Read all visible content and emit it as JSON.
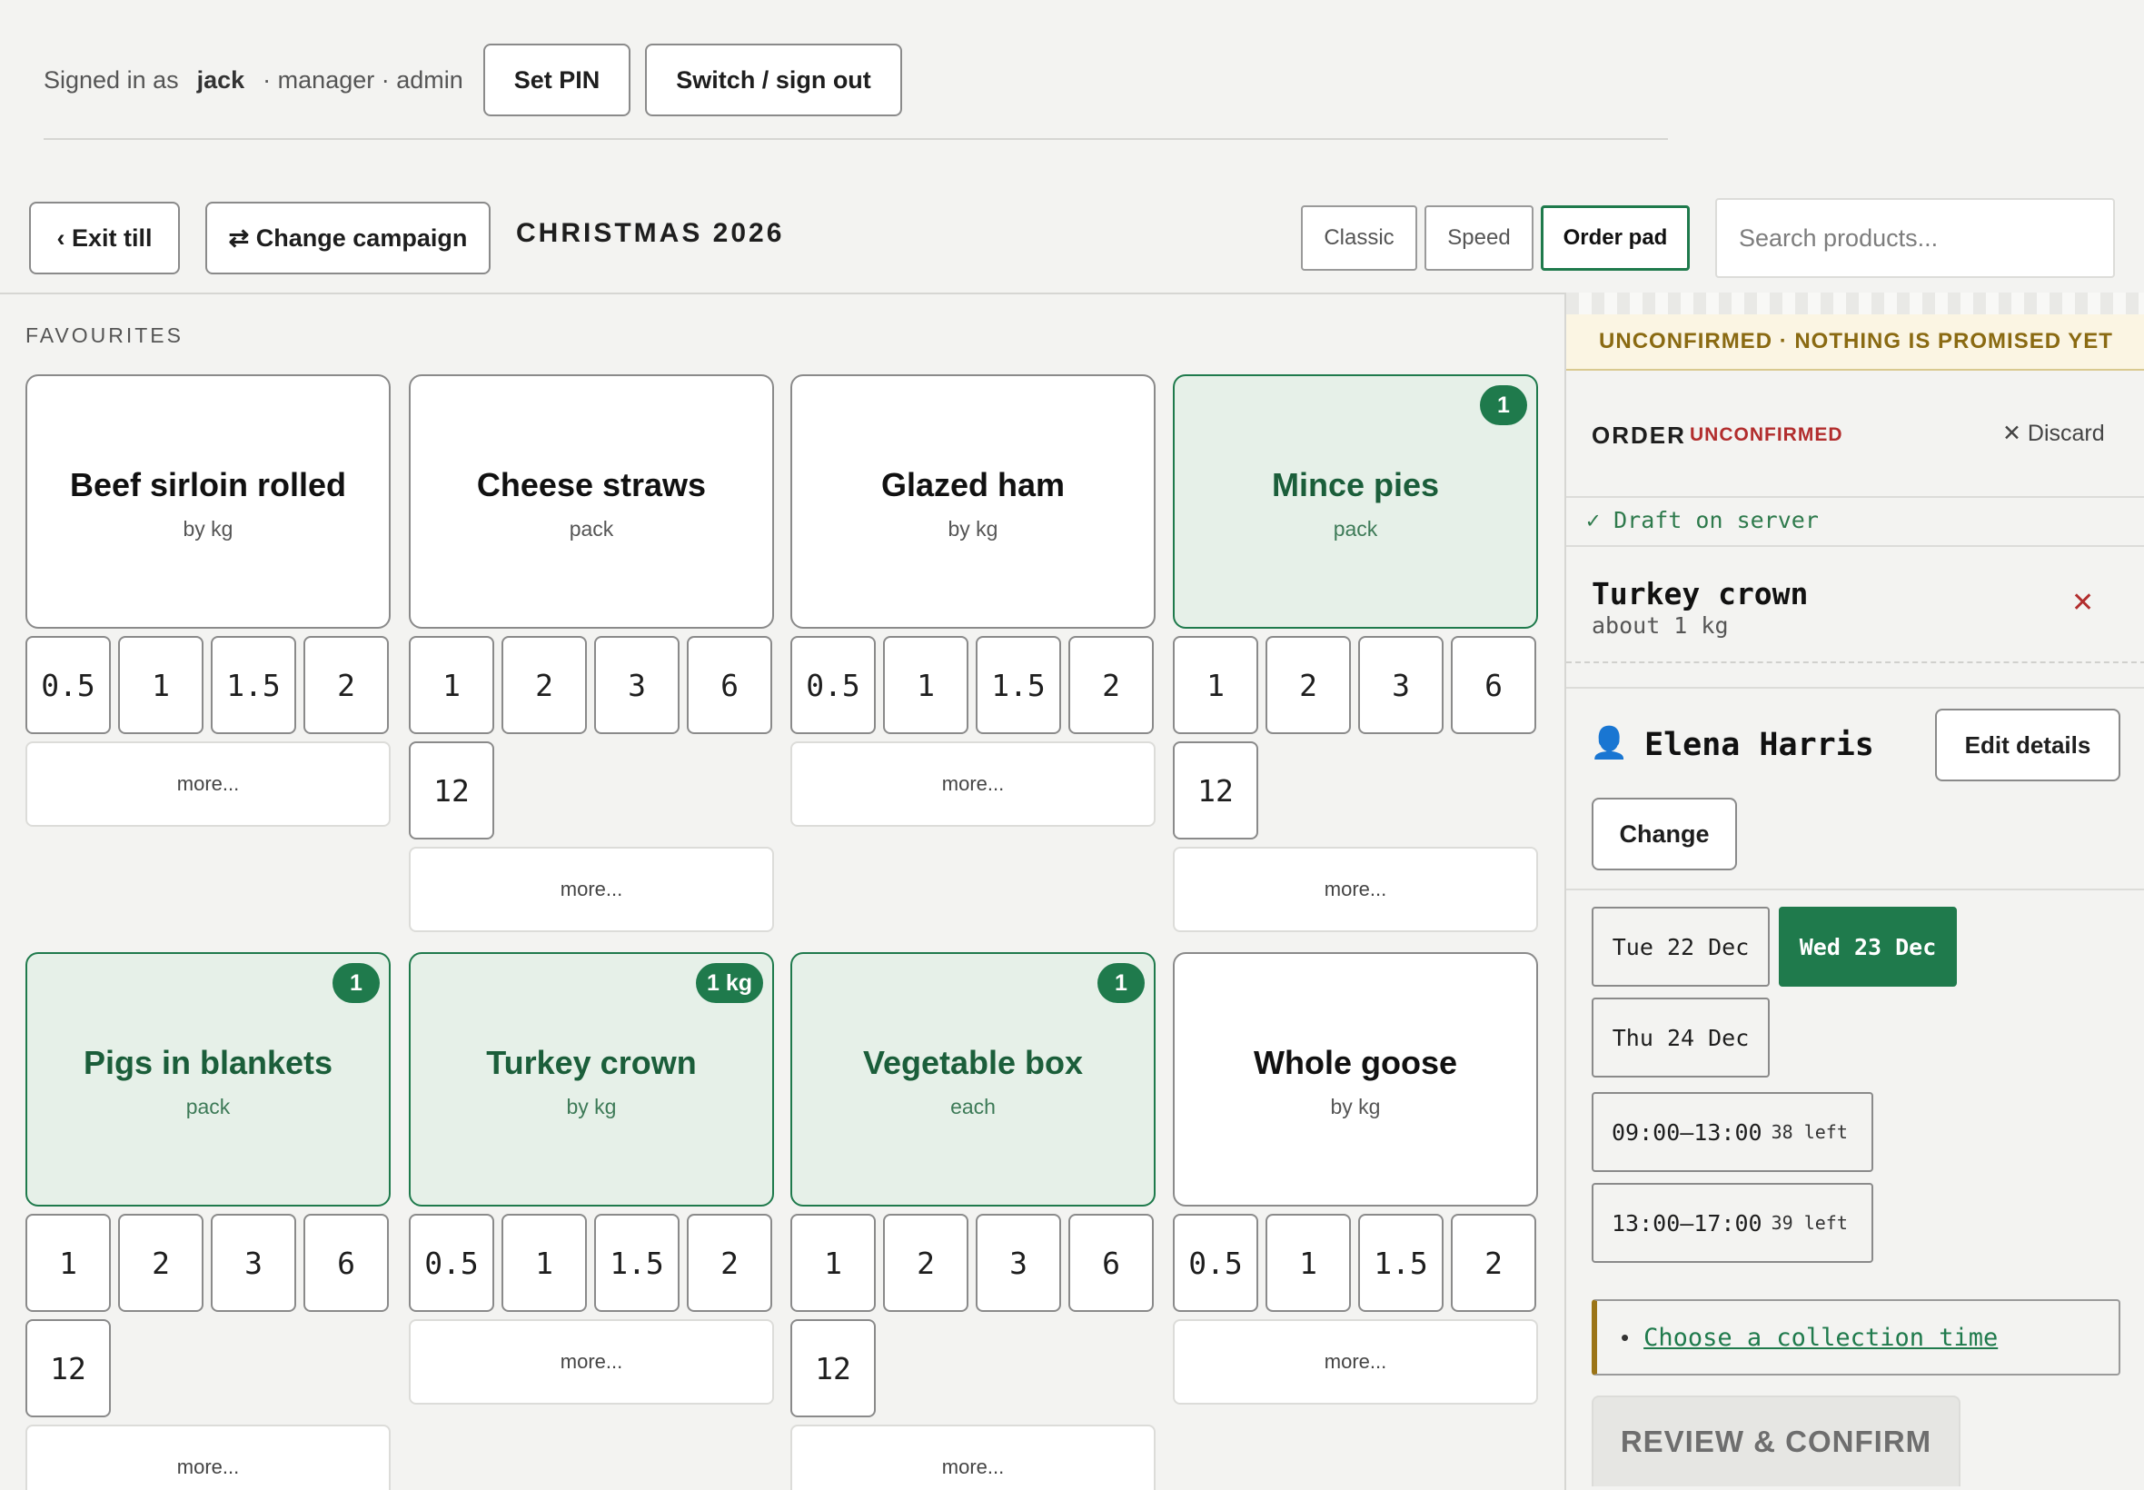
{
  "session": {
    "signed_in_label": "Signed in as",
    "user": "jack",
    "roles": "· manager · admin",
    "set_pin_label": "Set PIN",
    "switch_label": "Switch / sign out"
  },
  "toolbar": {
    "exit_label": "‹ Exit till",
    "change_campaign_label": "⇄ Change campaign",
    "campaign_name": "CHRISTMAS 2026",
    "modes": [
      "Classic",
      "Speed",
      "Order pad"
    ],
    "active_mode": "Order pad",
    "search_placeholder": "Search products..."
  },
  "favourites": {
    "label": "FAVOURITES",
    "more_label": "more...",
    "products": [
      {
        "name": "Beef sirloin rolled",
        "unit": "by kg",
        "selected": false,
        "badge": "",
        "qtys": [
          "0.5",
          "1",
          "1.5",
          "2"
        ]
      },
      {
        "name": "Cheese straws",
        "unit": "pack",
        "selected": false,
        "badge": "",
        "qtys": [
          "1",
          "2",
          "3",
          "6",
          "12"
        ]
      },
      {
        "name": "Glazed ham",
        "unit": "by kg",
        "selected": false,
        "badge": "",
        "qtys": [
          "0.5",
          "1",
          "1.5",
          "2"
        ]
      },
      {
        "name": "Mince pies",
        "unit": "pack",
        "selected": true,
        "badge": "1",
        "qtys": [
          "1",
          "2",
          "3",
          "6",
          "12"
        ]
      },
      {
        "name": "Pigs in blankets",
        "unit": "pack",
        "selected": true,
        "badge": "1",
        "qtys": [
          "1",
          "2",
          "3",
          "6",
          "12"
        ]
      },
      {
        "name": "Turkey crown",
        "unit": "by kg",
        "selected": true,
        "badge": "1 kg",
        "qtys": [
          "0.5",
          "1",
          "1.5",
          "2"
        ]
      },
      {
        "name": "Vegetable box",
        "unit": "each",
        "selected": true,
        "badge": "1",
        "qtys": [
          "1",
          "2",
          "3",
          "6",
          "12"
        ]
      },
      {
        "name": "Whole goose",
        "unit": "by kg",
        "selected": false,
        "badge": "",
        "qtys": [
          "0.5",
          "1",
          "1.5",
          "2"
        ]
      }
    ]
  },
  "order": {
    "banner": "UNCONFIRMED · NOTHING IS PROMISED YET",
    "title": "ORDER",
    "status": "UNCONFIRMED",
    "discard_label": "✕ Discard",
    "draft_status": "✓ Draft on server",
    "line": {
      "name": "Turkey crown",
      "qty": "about 1 kg",
      "remove": "✕"
    },
    "customer": {
      "name": "Elena Harris",
      "edit_label": "Edit details",
      "change_label": "Change"
    },
    "dates": [
      "Tue 22 Dec",
      "Wed 23 Dec",
      "Thu 24 Dec"
    ],
    "active_date": "Wed 23 Dec",
    "slots": [
      {
        "time": "09:00–13:00",
        "left": "38 left"
      },
      {
        "time": "13:00–17:00",
        "left": "39 left"
      }
    ],
    "alert": "Choose a collection time",
    "review_label": "REVIEW & CONFIRM"
  },
  "colors": {
    "accent": "#1f7a4c",
    "warning": "#b22d2d",
    "banner": "#fbf5e3"
  }
}
